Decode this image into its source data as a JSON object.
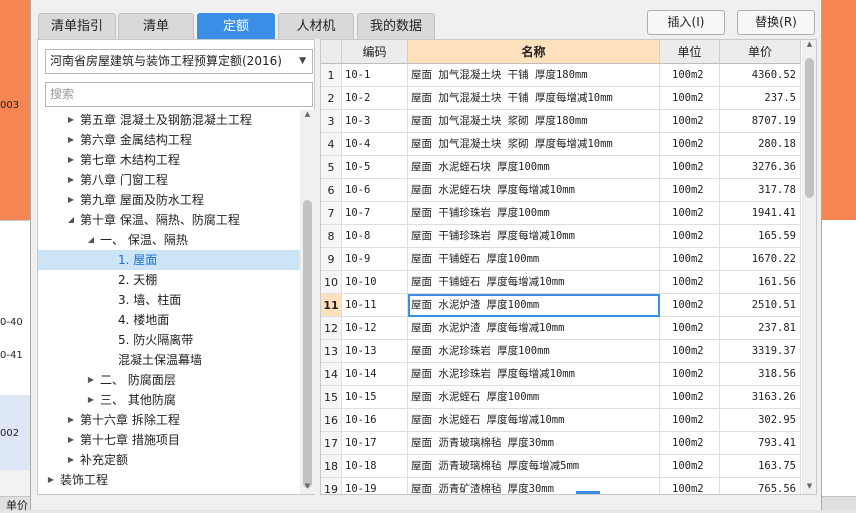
{
  "tabs": [
    {
      "label": "清单指引"
    },
    {
      "label": "清单"
    },
    {
      "label": "定额"
    },
    {
      "label": "人材机"
    },
    {
      "label": "我的数据"
    }
  ],
  "buttons": {
    "insert": "插入(I)",
    "replace": "替换(R)"
  },
  "library": {
    "selected": "河南省房屋建筑与装饰工程预算定额(2016)",
    "search_placeholder": "搜索"
  },
  "tree": [
    {
      "label": "第五章 混凝土及钢筋混凝土工程",
      "toggle": "▶"
    },
    {
      "label": "第六章 金属结构工程",
      "toggle": "▶"
    },
    {
      "label": "第七章 木结构工程",
      "toggle": "▶"
    },
    {
      "label": "第八章 门窗工程",
      "toggle": "▶"
    },
    {
      "label": "第九章 屋面及防水工程",
      "toggle": "▶"
    },
    {
      "label": "第十章 保温、隔热、防腐工程",
      "toggle": "◢"
    },
    {
      "label": "一、 保温、隔热",
      "toggle": "◢"
    },
    {
      "label": "1. 屋面",
      "toggle": ""
    },
    {
      "label": "2. 天棚",
      "toggle": ""
    },
    {
      "label": "3. 墙、柱面",
      "toggle": ""
    },
    {
      "label": "4. 楼地面",
      "toggle": ""
    },
    {
      "label": "5. 防火隔离带",
      "toggle": ""
    },
    {
      "label": "混凝土保温幕墙",
      "toggle": ""
    },
    {
      "label": "二、 防腐面层",
      "toggle": "▶"
    },
    {
      "label": "三、 其他防腐",
      "toggle": "▶"
    },
    {
      "label": "第十六章 拆除工程",
      "toggle": "▶"
    },
    {
      "label": "第十七章 措施项目",
      "toggle": "▶"
    },
    {
      "label": "补充定额",
      "toggle": "▶"
    },
    {
      "label": "装饰工程",
      "toggle": "▶"
    }
  ],
  "grid": {
    "headers": {
      "code": "编码",
      "name": "名称",
      "unit": "单位",
      "price": "单价"
    },
    "rows": [
      {
        "n": "1",
        "code": "10-1",
        "name": "屋面 加气混凝土块 干铺 厚度180mm",
        "unit": "100m2",
        "price": "4360.52"
      },
      {
        "n": "2",
        "code": "10-2",
        "name": "屋面 加气混凝土块 干铺 厚度每增减10mm",
        "unit": "100m2",
        "price": "237.5"
      },
      {
        "n": "3",
        "code": "10-3",
        "name": "屋面 加气混凝土块 浆砌 厚度180mm",
        "unit": "100m2",
        "price": "8707.19"
      },
      {
        "n": "4",
        "code": "10-4",
        "name": "屋面 加气混凝土块 浆砌 厚度每增减10mm",
        "unit": "100m2",
        "price": "280.18"
      },
      {
        "n": "5",
        "code": "10-5",
        "name": "屋面 水泥蛭石块 厚度100mm",
        "unit": "100m2",
        "price": "3276.36"
      },
      {
        "n": "6",
        "code": "10-6",
        "name": "屋面 水泥蛭石块 厚度每增减10mm",
        "unit": "100m2",
        "price": "317.78"
      },
      {
        "n": "7",
        "code": "10-7",
        "name": "屋面 干铺珍珠岩 厚度100mm",
        "unit": "100m2",
        "price": "1941.41"
      },
      {
        "n": "8",
        "code": "10-8",
        "name": "屋面 干铺珍珠岩 厚度每增减10mm",
        "unit": "100m2",
        "price": "165.59"
      },
      {
        "n": "9",
        "code": "10-9",
        "name": "屋面 干铺蛭石 厚度100mm",
        "unit": "100m2",
        "price": "1670.22"
      },
      {
        "n": "10",
        "code": "10-10",
        "name": "屋面 干铺蛭石 厚度每增减10mm",
        "unit": "100m2",
        "price": "161.56"
      },
      {
        "n": "11",
        "code": "10-11",
        "name": "屋面 水泥炉渣 厚度100mm",
        "unit": "100m2",
        "price": "2510.51"
      },
      {
        "n": "12",
        "code": "10-12",
        "name": "屋面 水泥炉渣 厚度每增减10mm",
        "unit": "100m2",
        "price": "237.81"
      },
      {
        "n": "13",
        "code": "10-13",
        "name": "屋面 水泥珍珠岩 厚度100mm",
        "unit": "100m2",
        "price": "3319.37"
      },
      {
        "n": "14",
        "code": "10-14",
        "name": "屋面 水泥珍珠岩 厚度每增减10mm",
        "unit": "100m2",
        "price": "318.56"
      },
      {
        "n": "15",
        "code": "10-15",
        "name": "屋面 水泥蛭石 厚度100mm",
        "unit": "100m2",
        "price": "3163.26"
      },
      {
        "n": "16",
        "code": "10-16",
        "name": "屋面 水泥蛭石 厚度每增减10mm",
        "unit": "100m2",
        "price": "302.95"
      },
      {
        "n": "17",
        "code": "10-17",
        "name": "屋面 沥青玻璃棉毡 厚度30mm",
        "unit": "100m2",
        "price": "793.41"
      },
      {
        "n": "18",
        "code": "10-18",
        "name": "屋面 沥青玻璃棉毡 厚度每增减5mm",
        "unit": "100m2",
        "price": "163.75"
      },
      {
        "n": "19",
        "code": "10-19",
        "name": "屋面 沥青矿渣棉毡 厚度30mm",
        "unit": "100m2",
        "price": "765.56"
      }
    ]
  },
  "background": {
    "frag1": "003",
    "frag2": "0-40",
    "frag3": "0-41",
    "frag4": "002",
    "frag5": "单价"
  }
}
